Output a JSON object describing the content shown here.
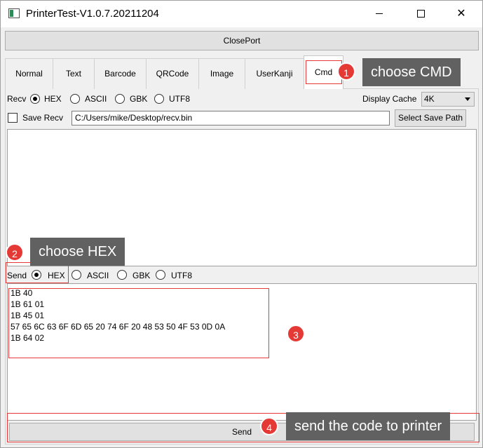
{
  "window": {
    "title": "PrinterTest-V1.0.7.20211204",
    "minimize_label": "—",
    "maximize_label": "□",
    "close_label": "✕"
  },
  "toolbar": {
    "closeport_label": "ClosePort"
  },
  "tabs": [
    {
      "label": "Normal"
    },
    {
      "label": "Text"
    },
    {
      "label": "Barcode"
    },
    {
      "label": "QRCode"
    },
    {
      "label": "Image"
    },
    {
      "label": "UserKanji"
    },
    {
      "label": "Cmd",
      "active": true
    }
  ],
  "recv": {
    "label": "Recv",
    "options": [
      "HEX",
      "ASCII",
      "GBK",
      "UTF8"
    ],
    "selected": "HEX",
    "display_cache_label": "Display Cache",
    "display_cache_value": "4K",
    "save_recv_label": "Save Recv",
    "save_recv_checked": false,
    "save_path": "C:/Users/mike/Desktop/recv.bin",
    "select_save_path_label": "Select Save Path",
    "content": ""
  },
  "send": {
    "label": "Send",
    "options": [
      "HEX",
      "ASCII",
      "GBK",
      "UTF8"
    ],
    "selected": "HEX",
    "lines": [
      "1B 40",
      "1B 61 01",
      "1B 45 01",
      "57 65 6C 63 6F 6D 65 20 74 6F 20 48 53 50 4F 53 0D 0A",
      "1B 64 02"
    ],
    "send_label": "Send"
  },
  "annotations": {
    "accent": "#e53935",
    "callout_bg": "#616161",
    "step1": {
      "number": "1",
      "text": "choose CMD"
    },
    "step2": {
      "number": "2",
      "text": "choose HEX"
    },
    "step3": {
      "number": "3"
    },
    "step4": {
      "number": "4",
      "text": "send the code to printer"
    }
  }
}
